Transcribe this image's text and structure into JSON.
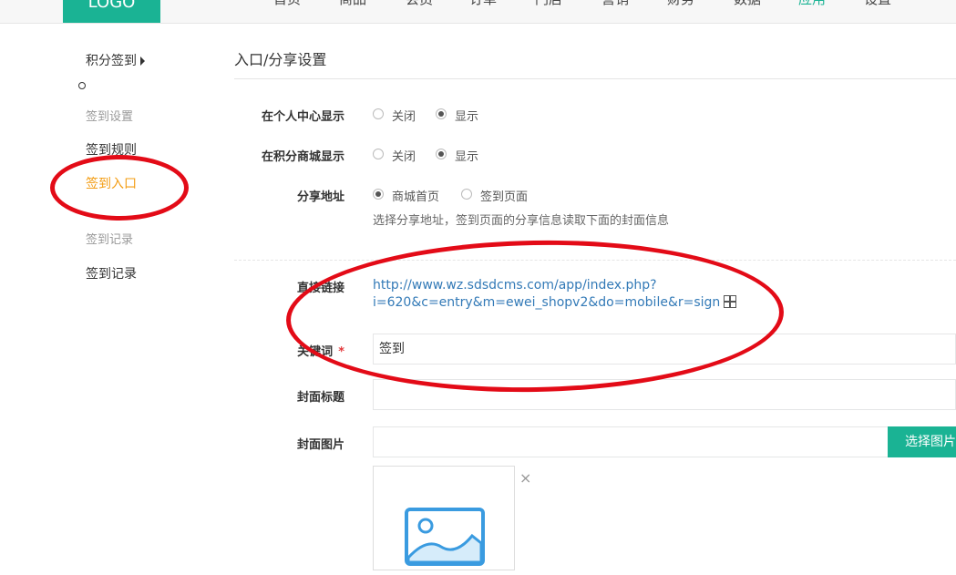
{
  "header": {
    "logo": "LOGO",
    "nav": [
      "首页",
      "商品",
      "会员",
      "订单",
      "门店",
      "营销",
      "财务",
      "数据",
      "应用",
      "设置"
    ],
    "active_index": 8
  },
  "sidebar": {
    "title": "积分签到",
    "items": [
      {
        "label": "签到设置",
        "style": "grey"
      },
      {
        "label": "签到规则",
        "style": "black"
      },
      {
        "label": "签到入口",
        "style": "orange"
      },
      {
        "label": "签到记录",
        "style": "grey"
      },
      {
        "label": "签到记录",
        "style": "black"
      }
    ]
  },
  "main": {
    "title": "入口/分享设置",
    "personal_center": {
      "label": "在个人中心显示",
      "options": [
        "关闭",
        "显示"
      ],
      "selected": 1
    },
    "points_mall": {
      "label": "在积分商城显示",
      "options": [
        "关闭",
        "显示"
      ],
      "selected": 1
    },
    "share": {
      "label": "分享地址",
      "options": [
        "商城首页",
        "签到页面"
      ],
      "selected": 0,
      "help": "选择分享地址，签到页面的分享信息读取下面的封面信息"
    },
    "direct_link": {
      "label": "直接链接",
      "line1": "http://www.wz.sdsdcms.com/app/index.php?",
      "line2": "i=620&c=entry&m=ewei_shopv2&do=mobile&r=sign"
    },
    "keyword": {
      "label": "关键词",
      "required": "*",
      "value": "签到"
    },
    "cover_title": {
      "label": "封面标题",
      "value": ""
    },
    "cover_image": {
      "label": "封面图片",
      "value": "",
      "button": "选择图片",
      "remove": "×"
    }
  },
  "colors": {
    "brand": "#1ab394",
    "accent_orange": "#f39c12",
    "link": "#337ab7",
    "annotation": "#e30b17"
  }
}
